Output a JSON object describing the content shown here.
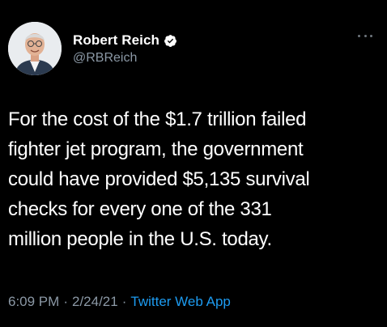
{
  "tweet": {
    "author": {
      "display_name": "Robert Reich",
      "handle": "@RBReich",
      "verified": true
    },
    "text_lines": [
      "For the cost of the $1.7 trillion failed",
      "fighter jet program, the government",
      "could have provided $5,135 survival",
      "checks for every one of the 331",
      "million people in the U.S. today."
    ],
    "time": "6:09 PM",
    "date": "2/24/21",
    "separator": "·",
    "source_app": "Twitter Web App"
  },
  "icons": {
    "verified": "verified-badge-icon",
    "more": "more-options-icon"
  },
  "colors": {
    "background": "#000000",
    "text": "#ffffff",
    "secondary": "#8b98a5",
    "link": "#1d9bf0"
  }
}
